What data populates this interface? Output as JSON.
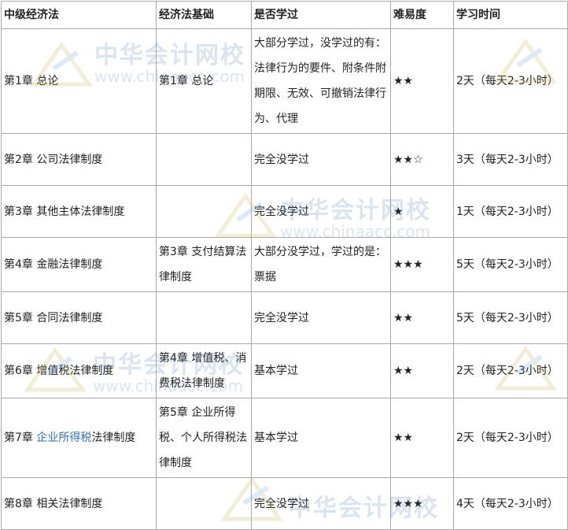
{
  "headers": [
    "中级经济法",
    "经济法基础",
    "是否学过",
    "难易度",
    "学习时间"
  ],
  "rows": [
    {
      "c1": "第1章 总论",
      "c1_pre": "",
      "c1_link": "",
      "c1_post": "",
      "c2": "第1章 总论",
      "c3": "大部分学过，没学过的有：法律行为的要件、附条件附期限、无效、可撤销法律行为、代理",
      "c4": "★★",
      "c5": "2天（每天2-3小时）"
    },
    {
      "c1": "第2章 公司法律制度",
      "c1_pre": "",
      "c1_link": "",
      "c1_post": "",
      "c2": "",
      "c3": "完全没学过",
      "c4": "★★☆",
      "c5": "3天（每天2-3小时）"
    },
    {
      "c1": "第3章 其他主体法律制度",
      "c1_pre": "",
      "c1_link": "",
      "c1_post": "",
      "c2": "",
      "c3": "完全没学过",
      "c4": "★",
      "c5": "1天（每天2-3小时）"
    },
    {
      "c1": "第4章 金融法律制度",
      "c1_pre": "",
      "c1_link": "",
      "c1_post": "",
      "c2": "第3章 支付结算法律制度",
      "c3": "大部分没学过，学过的是：票据",
      "c4": "★★★",
      "c5": "5天（每天2-3小时）"
    },
    {
      "c1": "第5章 合同法律制度",
      "c1_pre": "",
      "c1_link": "",
      "c1_post": "",
      "c2": "",
      "c3": "完全没学过",
      "c4": "★★",
      "c5": "5天（每天2-3小时）"
    },
    {
      "c1": "第6章 增值税法律制度",
      "c1_pre": "",
      "c1_link": "",
      "c1_post": "",
      "c2": "第4章 增值税、消费税法律制度",
      "c3": "基本学过",
      "c4": "★★",
      "c5": "2天（每天2-3小时）"
    },
    {
      "c1": "",
      "c1_pre": "第7章 ",
      "c1_link": "企业所得税",
      "c1_post": "法律制度",
      "c2": "第5章 企业所得税、个人所得税法律制度",
      "c3": "基本学过",
      "c4": "★★",
      "c5": "2天（每天2-3小时）"
    },
    {
      "c1": "第8章 相关法律制度",
      "c1_pre": "",
      "c1_link": "",
      "c1_post": "",
      "c2": "",
      "c3": "完全没学过",
      "c4": "★★★",
      "c5": "4天（每天2-3小时）"
    }
  ],
  "watermark": {
    "cn": "中华会计网校",
    "en": "www.chinaacc.com"
  },
  "colors": {
    "border": "#aaaaaa",
    "link": "#2f73b8",
    "watermark": "#3a6fb0"
  }
}
